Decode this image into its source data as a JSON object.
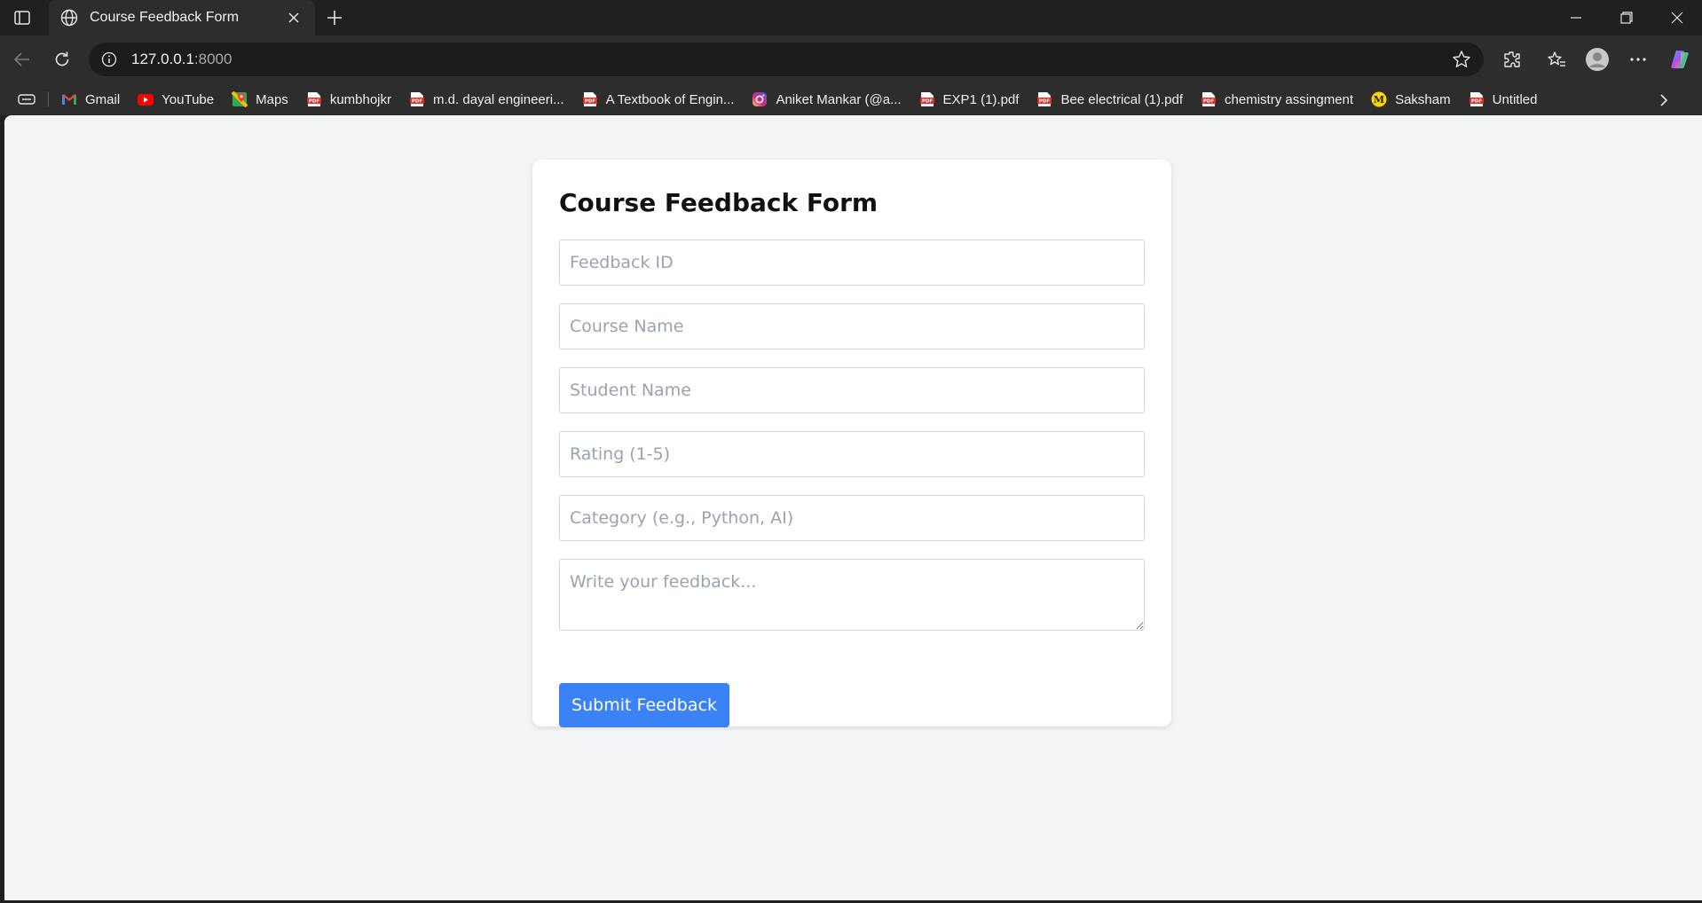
{
  "browser": {
    "tab": {
      "title": "Course Feedback Form"
    },
    "address": {
      "host": "127.0.0.1",
      "port": ":8000"
    },
    "bookmarks": [
      {
        "label": "Gmail",
        "icon": "gmail-icon"
      },
      {
        "label": "YouTube",
        "icon": "youtube-icon"
      },
      {
        "label": "Maps",
        "icon": "maps-icon"
      },
      {
        "label": "kumbhojkr",
        "icon": "pdf-icon"
      },
      {
        "label": "m.d. dayal engineeri...",
        "icon": "pdf-icon"
      },
      {
        "label": "A Textbook of Engin...",
        "icon": "pdf-icon"
      },
      {
        "label": "Aniket Mankar (@a...",
        "icon": "instagram-icon"
      },
      {
        "label": "EXP1 (1).pdf",
        "icon": "pdf-icon"
      },
      {
        "label": "Bee electrical (1).pdf",
        "icon": "pdf-icon"
      },
      {
        "label": "chemistry assingment",
        "icon": "pdf-icon"
      },
      {
        "label": "Saksham",
        "icon": "saksham-icon"
      },
      {
        "label": "Untitled",
        "icon": "pdf-icon"
      }
    ],
    "colors": {
      "chrome_bg": "#202020",
      "toolbar_bg": "#2d2d2d"
    }
  },
  "form": {
    "title": "Course Feedback Form",
    "fields": {
      "feedback_id": {
        "placeholder": "Feedback ID",
        "value": ""
      },
      "course_name": {
        "placeholder": "Course Name",
        "value": ""
      },
      "student_name": {
        "placeholder": "Student Name",
        "value": ""
      },
      "rating": {
        "placeholder": "Rating (1-5)",
        "value": ""
      },
      "category": {
        "placeholder": "Category (e.g., Python, AI)",
        "value": ""
      },
      "feedback": {
        "placeholder": "Write your feedback...",
        "value": ""
      }
    },
    "submit_label": "Submit Feedback",
    "colors": {
      "accent": "#3b82f6",
      "page_bg": "#f3f4f6",
      "card_bg": "#ffffff"
    }
  }
}
